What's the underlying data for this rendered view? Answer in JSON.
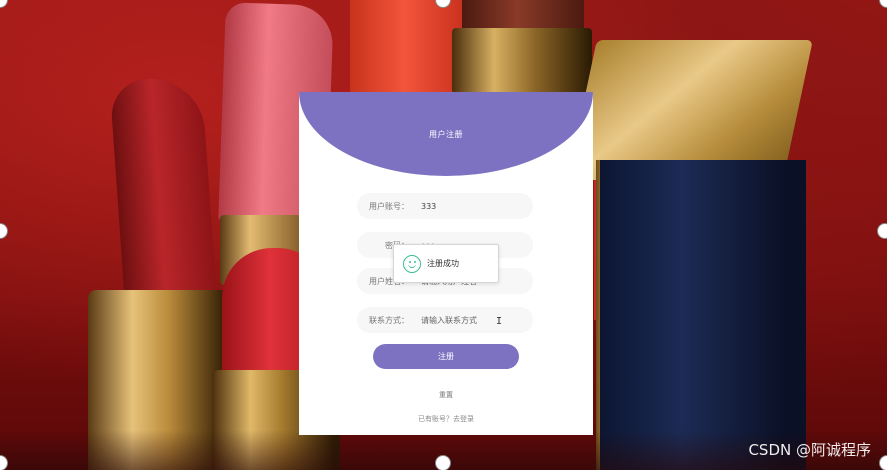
{
  "card": {
    "title": "用户注册",
    "fields": [
      {
        "label": "用户账号：",
        "value": "333",
        "placeholder": ""
      },
      {
        "label": "密码：",
        "value": "•••",
        "placeholder": ""
      },
      {
        "label": "用户姓名：",
        "value": "",
        "placeholder": "请输入用户姓名"
      },
      {
        "label": "联系方式：",
        "value": "",
        "placeholder": "请输入联系方式"
      }
    ],
    "register_label": "注册",
    "reset_label": "重置",
    "login_link": "已有账号？去登录"
  },
  "toast": {
    "text": "注册成功",
    "icon": "smile-icon"
  },
  "watermark": "CSDN @阿诚程序",
  "colors": {
    "accent": "#7d72c2",
    "success": "#3bbf8e"
  }
}
